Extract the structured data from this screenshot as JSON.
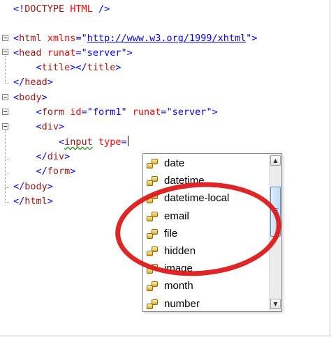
{
  "editor": {
    "lines": {
      "l1": {
        "open": "<!",
        "kw": "DOCTYPE",
        "sp": " ",
        "name": "HTML",
        "close": " />"
      },
      "l3": {
        "open": "<",
        "tag": "html",
        "attr": " xmlns",
        "eq": "=\"",
        "url": "http://www.w3.org/1999/xhtml",
        "close": "\">"
      },
      "l4": {
        "open": "<",
        "tag": "head",
        "attr": " runat",
        "eq": "=\"",
        "val": "server",
        "close": "\">"
      },
      "l5": {
        "indent": "    ",
        "open": "<",
        "tag": "title",
        "mid": "></",
        "tag2": "title",
        "close": ">"
      },
      "l6": {
        "open": "</",
        "tag": "head",
        "close": ">"
      },
      "l7": {
        "open": "<",
        "tag": "body",
        "close": ">"
      },
      "l8": {
        "indent": "    ",
        "open": "<",
        "tag": "form",
        "attr": " id",
        "eq": "=\"",
        "val": "form1",
        "q": "\"",
        "attr2": " runat",
        "eq2": "=\"",
        "val2": "server",
        "close": "\">"
      },
      "l9": {
        "indent": "    ",
        "open": "<",
        "tag": "div",
        "close": ">"
      },
      "l10": {
        "indent": "        ",
        "open": "<",
        "tag": "input",
        "attr": " type",
        "eq": "="
      },
      "l11": {
        "indent": "    ",
        "open": "</",
        "tag": "div",
        "close": ">"
      },
      "l12": {
        "indent": "    ",
        "open": "</",
        "tag": "form",
        "close": ">"
      },
      "l13": {
        "open": "</",
        "tag": "body",
        "close": ">"
      },
      "l14": {
        "open": "</",
        "tag": "html",
        "close": ">"
      }
    }
  },
  "intellisense": {
    "items": [
      "date",
      "datetime",
      "datetime-local",
      "email",
      "file",
      "hidden",
      "image",
      "month",
      "number"
    ],
    "icon": "enum-value-icon",
    "scroll_up": "▲",
    "scroll_down": "▼"
  },
  "colors": {
    "tag": "#a31515",
    "attribute": "#ff0000",
    "value": "#0000ff",
    "highlight_ellipse": "#dd1a1a"
  }
}
